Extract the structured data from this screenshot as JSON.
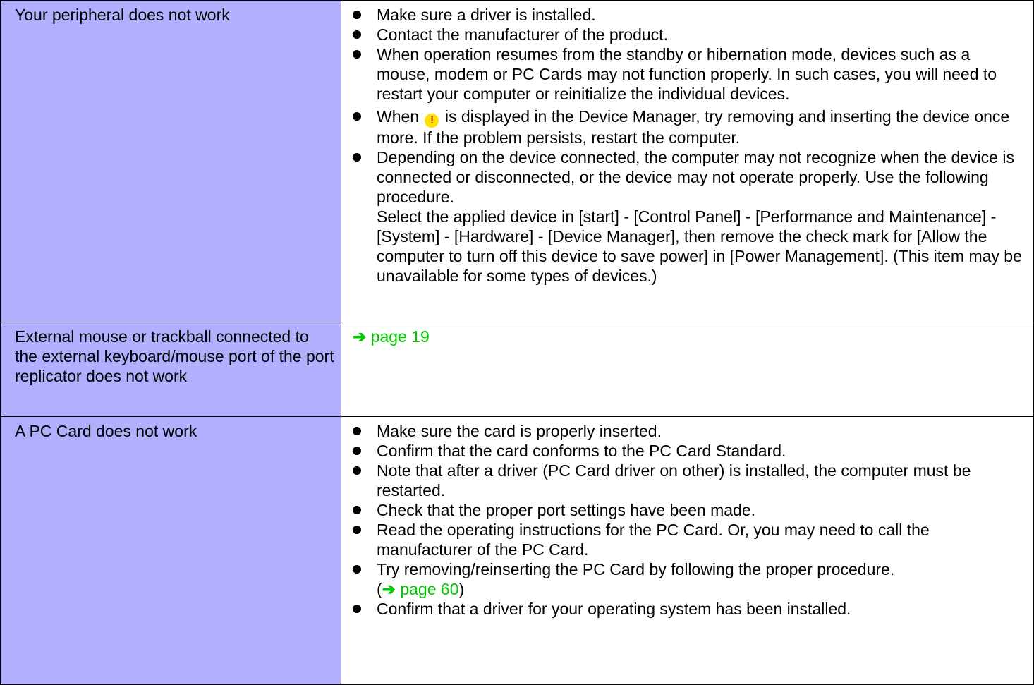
{
  "rows": [
    {
      "problem": "Your peripheral does not work",
      "items": [
        "Make sure a driver is installed.",
        "Contact the manufacturer of the product.",
        "When operation resumes from the standby or hibernation mode, devices such as a mouse, modem or PC Cards may not function properly.   In such cases, you will need to restart your computer or reinitialize the individual devices.",
        {
          "before": "When",
          "icon": "device-manager-warning-icon",
          "icon_glyph": "!",
          "after": "is displayed in the Device Manager, try removing and inserting the device once more.  If the problem persists, restart the computer."
        },
        {
          "text": "Depending on the device connected, the computer may not recognize when the device is connected or disconnected, or the device may not operate properly. Use the following procedure.",
          "extra": "Select the applied device in [start] - [Control Panel] - [Performance and Maintenance] - [System] - [Hardware] - [Device Manager], then remove the check mark for [Allow the computer to turn off this device to save power] in [Power Management]. (This item may be unavailable for some types of devices.)"
        }
      ]
    },
    {
      "problem": "External mouse or trackball connected to the external keyboard/mouse port of the port replicator does not work",
      "link_arrow": "➔",
      "link_text": "page 19"
    },
    {
      "problem": "A PC Card does not work",
      "items": [
        "Make sure the card is properly inserted.",
        "Confirm that the card conforms to the PC Card Standard.",
        "Note that after a driver (PC Card driver on other) is installed, the computer must be restarted.",
        "Check that the proper port settings have been made.",
        "Read the operating instructions for the PC Card.  Or, you may need to call the manufacturer of the PC Card.",
        {
          "text": "Try removing/reinserting the PC Card by following the proper procedure.",
          "paren_open": "(",
          "link_arrow": "➔",
          "link_text": "page 60",
          "paren_close": ")"
        },
        "Confirm that a driver for your operating system has been installed."
      ]
    }
  ],
  "colors": {
    "problem_bg": "#b0b0ff",
    "link": "#00c800",
    "warning_icon": "#ffe000"
  }
}
